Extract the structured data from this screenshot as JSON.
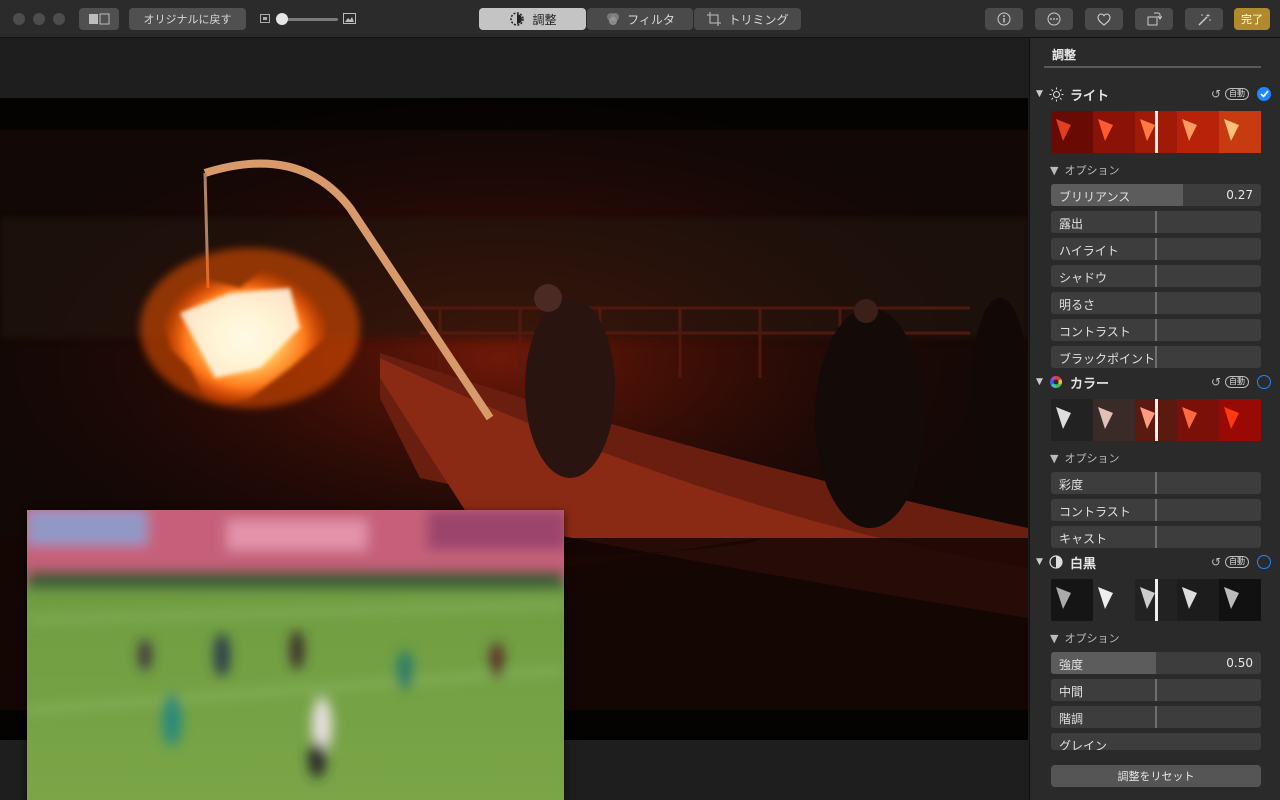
{
  "toolbar": {
    "revert_label": "オリジナルに戻す",
    "tabs": [
      {
        "label": "調整",
        "icon": "adjust-icon",
        "selected": true
      },
      {
        "label": "フィルタ",
        "icon": "filters-icon",
        "selected": false
      },
      {
        "label": "トリミング",
        "icon": "crop-icon",
        "selected": false
      }
    ],
    "done_label": "完了",
    "right_icons": [
      "info-icon",
      "more-icon",
      "heart-icon",
      "rotate-icon",
      "magic-wand-icon"
    ]
  },
  "panel": {
    "title": "調整",
    "sections": [
      {
        "name": "light",
        "label": "ライト",
        "icon": "sun-icon",
        "auto_label": "自動",
        "enabled": true,
        "options_label": "オプション",
        "rows": [
          {
            "label": "ブリリアンス",
            "value": "0.27"
          },
          {
            "label": "露出",
            "value": ""
          },
          {
            "label": "ハイライト",
            "value": ""
          },
          {
            "label": "シャドウ",
            "value": ""
          },
          {
            "label": "明るさ",
            "value": ""
          },
          {
            "label": "コントラスト",
            "value": ""
          },
          {
            "label": "ブラックポイント",
            "value": ""
          }
        ]
      },
      {
        "name": "color",
        "label": "カラー",
        "icon": "color-wheel-icon",
        "auto_label": "自動",
        "enabled": false,
        "options_label": "オプション",
        "rows": [
          {
            "label": "彩度",
            "value": ""
          },
          {
            "label": "コントラスト",
            "value": ""
          },
          {
            "label": "キャスト",
            "value": ""
          }
        ]
      },
      {
        "name": "bw",
        "label": "白黒",
        "icon": "half-circle-icon",
        "auto_label": "自動",
        "enabled": false,
        "options_label": "オプション",
        "rows": [
          {
            "label": "強度",
            "value": "0.50"
          },
          {
            "label": "中間",
            "value": ""
          },
          {
            "label": "階調",
            "value": ""
          },
          {
            "label": "グレイン",
            "value": ""
          }
        ]
      }
    ],
    "reset_label": "調整をリセット"
  },
  "colors": {
    "accent": "#1e88ff",
    "done": "#b08a2c"
  }
}
